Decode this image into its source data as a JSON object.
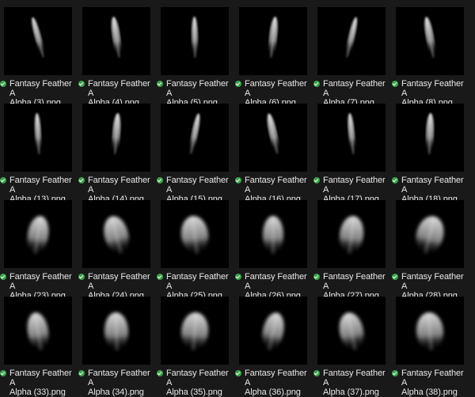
{
  "status_icon": "sync-ok-check-icon",
  "status_color": "#3aa34a",
  "files": [
    [
      "Fantasy Feather A",
      "Alpha (3).png"
    ],
    [
      "Fantasy Feather A",
      "Alpha (4).png"
    ],
    [
      "Fantasy Feather A",
      "Alpha (5).png"
    ],
    [
      "Fantasy Feather A",
      "Alpha (6).png"
    ],
    [
      "Fantasy Feather A",
      "Alpha (7).png"
    ],
    [
      "Fantasy Feather A",
      "Alpha (8).png"
    ],
    [
      "Fantasy Feather A",
      "Alpha (13).png"
    ],
    [
      "Fantasy Feather A",
      "Alpha (14).png"
    ],
    [
      "Fantasy Feather A",
      "Alpha (15).png"
    ],
    [
      "Fantasy Feather A",
      "Alpha (16).png"
    ],
    [
      "Fantasy Feather A",
      "Alpha (17).png"
    ],
    [
      "Fantasy Feather A",
      "Alpha (18).png"
    ],
    [
      "Fantasy Feather A",
      "Alpha (23).png"
    ],
    [
      "Fantasy Feather A",
      "Alpha (24).png"
    ],
    [
      "Fantasy Feather A",
      "Alpha (25).png"
    ],
    [
      "Fantasy Feather A",
      "Alpha (26).png"
    ],
    [
      "Fantasy Feather A",
      "Alpha (27).png"
    ],
    [
      "Fantasy Feather A",
      "Alpha (28).png"
    ],
    [
      "Fantasy Feather A",
      "Alpha (33).png"
    ],
    [
      "Fantasy Feather A",
      "Alpha (34).png"
    ],
    [
      "Fantasy Feather A",
      "Alpha (35).png"
    ],
    [
      "Fantasy Feather A",
      "Alpha (36).png"
    ],
    [
      "Fantasy Feather A",
      "Alpha (37).png"
    ],
    [
      "Fantasy Feather A",
      "Alpha (38).png"
    ]
  ]
}
